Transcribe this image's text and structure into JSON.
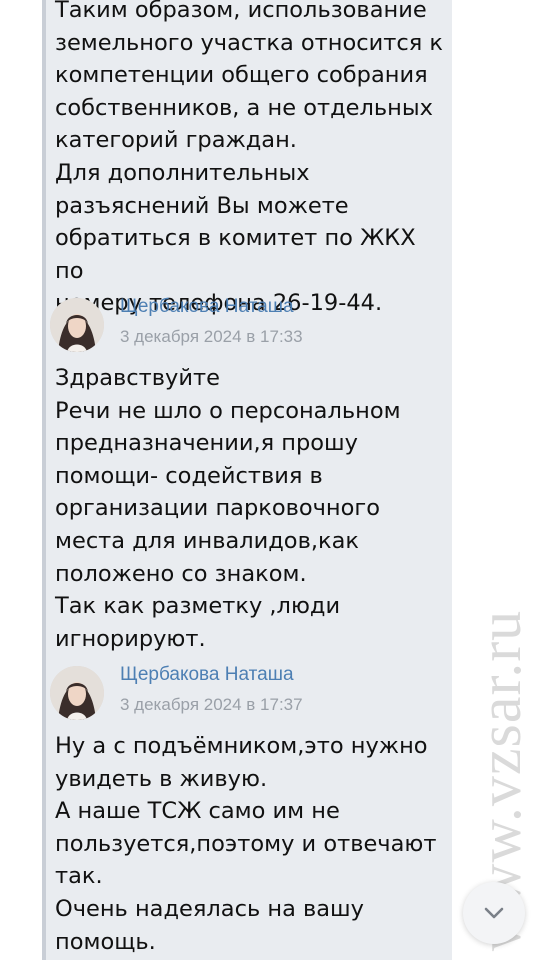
{
  "quoted_message": {
    "text": "Таким образом, использование\nземельного участка относится к\nкомпетенции общего собрания\nсобственников, а не отдельных\nкатегорий граждан.\nДля дополнительных\nразъяснений Вы можете\nобратиться в комитет по ЖКХ по\nномеру телефона 26-19-44."
  },
  "messages": [
    {
      "author": "Щербакова Наташа",
      "time": "3 декабря 2024 в 17:33",
      "text": "Здравствуйте\nРечи не шло о персональном\nпредназначении,я прошу\nпомощи- содействия в\nорганизации парковочного\nместа для инвалидов,как\nположено со знаком.\nТак как разметку ,люди\nигнорируют."
    },
    {
      "author": "Щербакова Наташа",
      "time": "3 декабря 2024 в 17:37",
      "text": "Ну а с подъёмником,это нужно\nувидеть в живую.\nА наше ТСЖ само им не\nпользуется,поэтому и отвечают\nтак.\nОчень надеялась на вашу\nпомощь."
    }
  ],
  "watermark": "www.vzsar.ru",
  "scroll_button": {
    "icon": "chevron-down-icon"
  },
  "colors": {
    "bubble_bg": "#e9ecf0",
    "author": "#4d7fb3",
    "time": "#9aa0a8",
    "text": "#111111"
  }
}
